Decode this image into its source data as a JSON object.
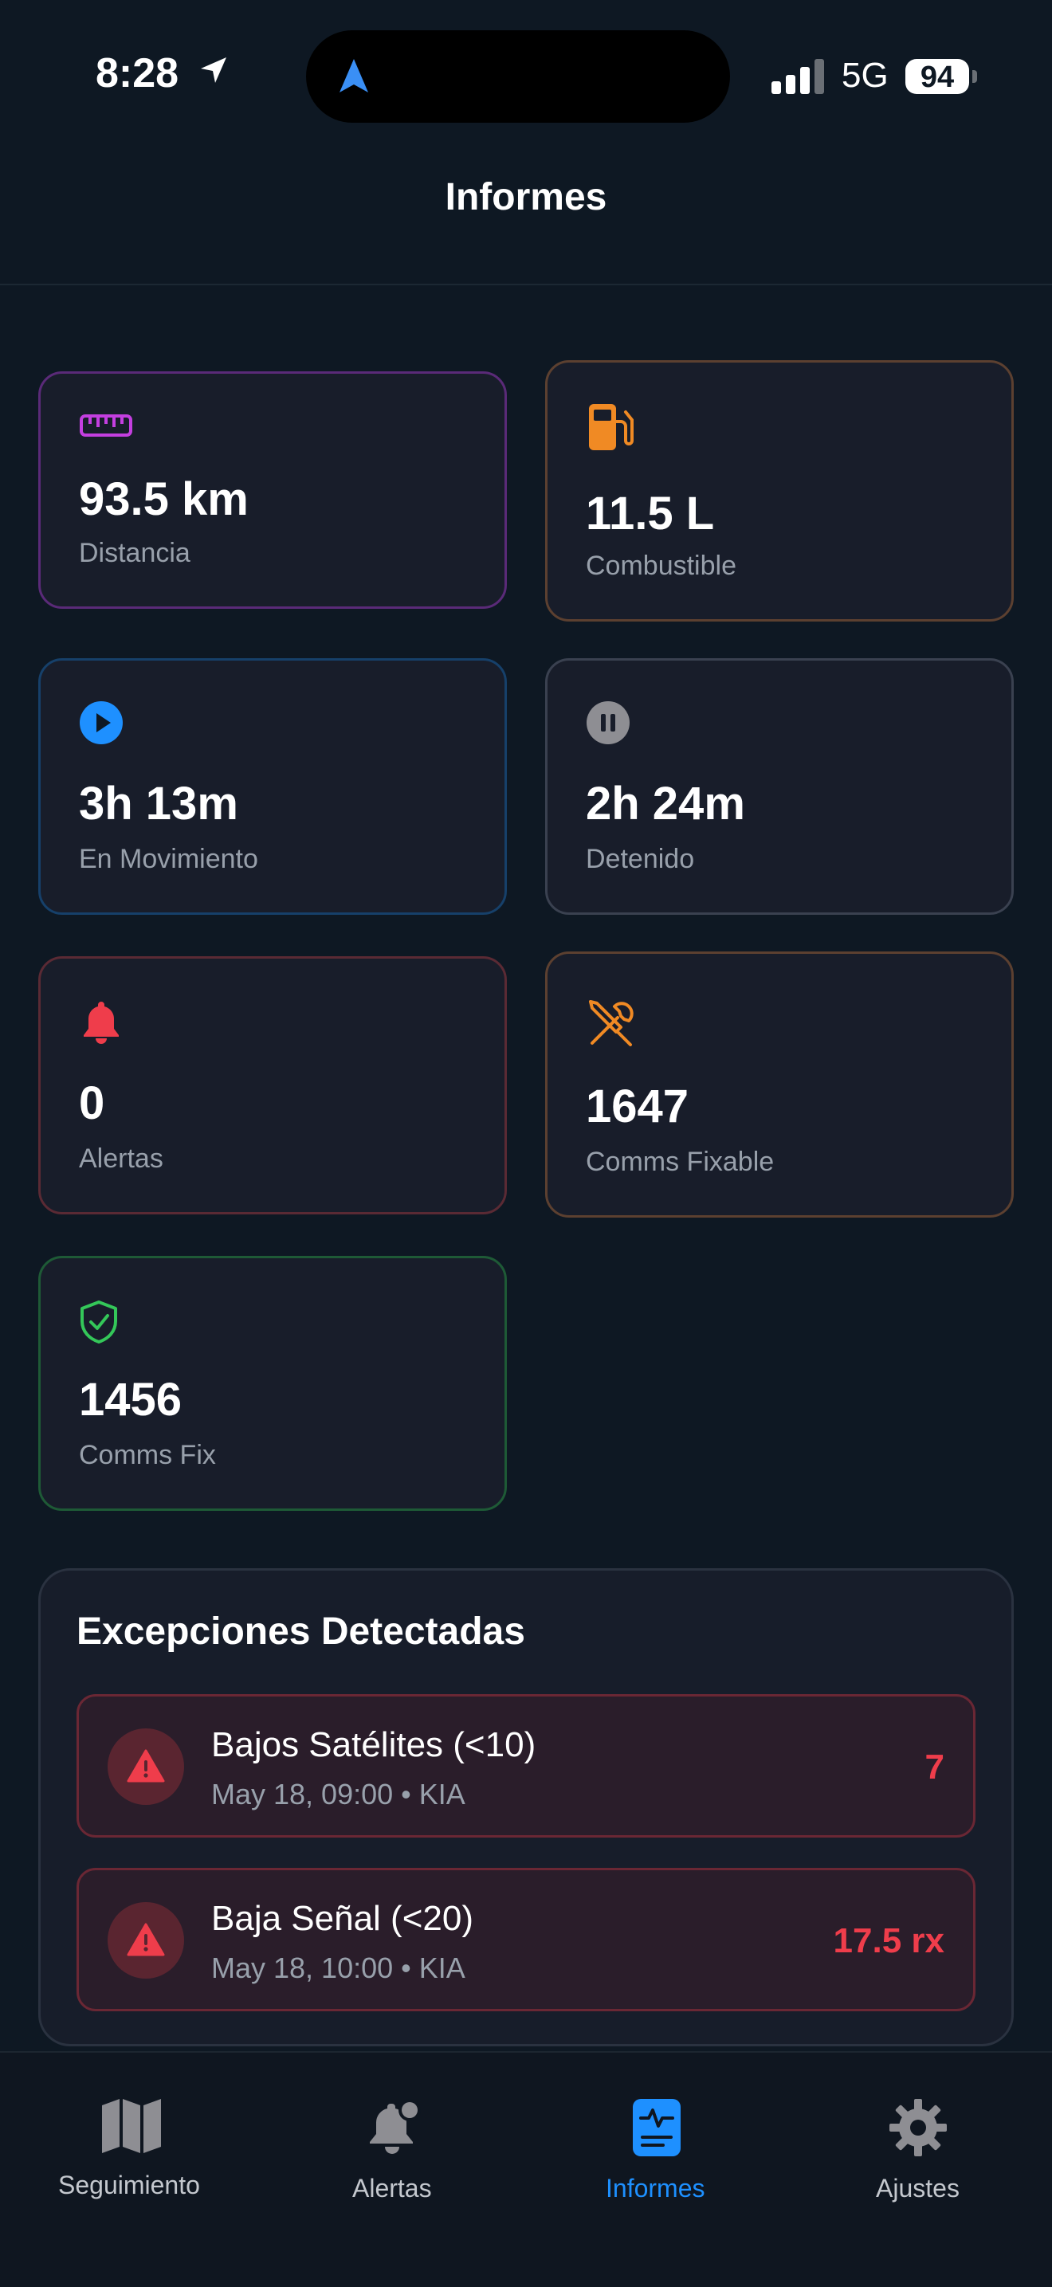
{
  "status_bar": {
    "time": "8:28",
    "network": "5G",
    "battery": "94"
  },
  "header": {
    "title": "Informes"
  },
  "stats": {
    "distance": {
      "value": "93.5 km",
      "label": "Distancia",
      "icon": "ruler-icon",
      "color": "#c43fe0"
    },
    "fuel": {
      "value": "11.5 L",
      "label": "Combustible",
      "icon": "fuel-pump-icon",
      "color": "#f08a24"
    },
    "moving": {
      "value": "3h 13m",
      "label": "En Movimiento",
      "icon": "play-circle-icon",
      "color": "#1e90ff"
    },
    "stopped": {
      "value": "2h 24m",
      "label": "Detenido",
      "icon": "pause-circle-icon",
      "color": "#8e8e93"
    },
    "alerts": {
      "value": "0",
      "label": "Alertas",
      "icon": "bell-icon",
      "color": "#ef3d4b"
    },
    "comms_fixable": {
      "value": "1647",
      "label": "Comms Fixable",
      "icon": "wrench-screwdriver-icon",
      "color": "#f08a24"
    },
    "comms_fix": {
      "value": "1456",
      "label": "Comms Fix",
      "icon": "shield-check-icon",
      "color": "#34c759"
    }
  },
  "exceptions": {
    "title": "Excepciones Detectadas",
    "items": [
      {
        "name": "Bajos Satélites (<10)",
        "meta": "May 18, 09:00 • KIA",
        "value": "7"
      },
      {
        "name": "Baja Señal (<20)",
        "meta": "May 18, 10:00 • KIA",
        "value": "17.5 rx"
      }
    ]
  },
  "tabbar": {
    "tabs": [
      {
        "label": "Seguimiento",
        "icon": "map-icon"
      },
      {
        "label": "Alertas",
        "icon": "bell-badge-icon"
      },
      {
        "label": "Informes",
        "icon": "report-icon",
        "active": true
      },
      {
        "label": "Ajustes",
        "icon": "gear-icon"
      }
    ]
  },
  "colors": {
    "background": "#0e1823",
    "accent": "#1e90ff",
    "danger": "#ef3d4b"
  }
}
